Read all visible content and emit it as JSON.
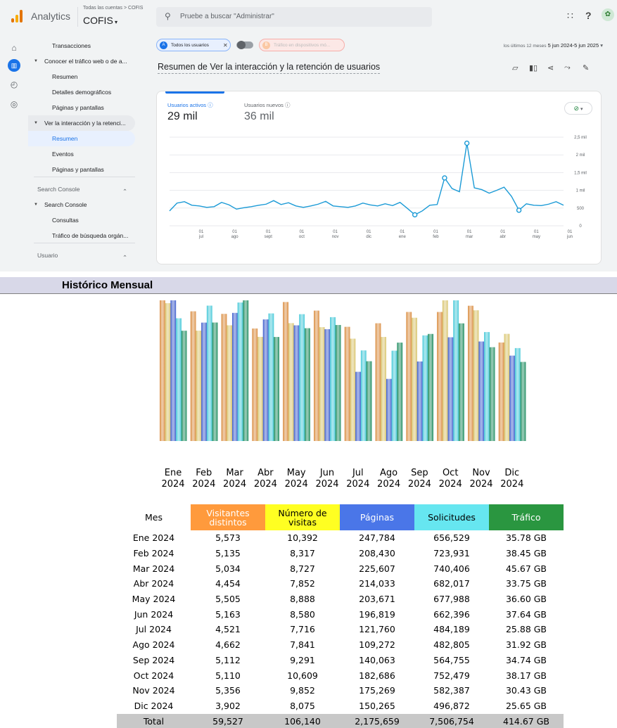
{
  "colors": {
    "accent": "#1a73e8",
    "line": "#1a9ad6",
    "bar_visitantes": "#d98a3c",
    "bar_visitas": "#d8c36a",
    "bar_paginas": "#3d5ccc",
    "bar_solicitudes": "#43c8d8",
    "bar_trafico": "#1a8a5c",
    "hdr_visitantes": "#ff9a3c",
    "hdr_visitas": "#ffff22",
    "hdr_paginas": "#4a76e8",
    "hdr_solicitudes": "#66e6f0",
    "hdr_trafico": "#2a9640"
  },
  "topbar": {
    "app_name": "Analytics",
    "crumb": "Todas las cuentas > COFIS",
    "account": "COFIS",
    "search_placeholder": "Pruebe a buscar \"Administrar\""
  },
  "rail": {
    "icons": [
      "home-icon",
      "reports-icon",
      "explore-icon",
      "advertising-icon"
    ]
  },
  "sidebar": {
    "items": [
      {
        "label": "Transacciones",
        "indent": 2
      },
      {
        "label": "Conocer el tráfico web o de a...",
        "indent": 1,
        "expand": true
      },
      {
        "label": "Resumen",
        "indent": 2
      },
      {
        "label": "Detalles demográficos",
        "indent": 2
      },
      {
        "label": "Páginas y pantallas",
        "indent": 2
      },
      {
        "label": "Ver la interacción y la retenci...",
        "indent": 1,
        "expand": true,
        "highlight": true
      },
      {
        "label": "Resumen",
        "indent": 2,
        "selected": true
      },
      {
        "label": "Eventos",
        "indent": 2
      },
      {
        "label": "Páginas y pantallas",
        "indent": 2
      },
      {
        "label": "Search Console",
        "indent": 0,
        "section": true
      },
      {
        "label": "Search Console",
        "indent": 1,
        "expand": true
      },
      {
        "label": "Consultas",
        "indent": 2
      },
      {
        "label": "Tráfico de búsqueda orgán...",
        "indent": 2
      },
      {
        "label": "Usuario",
        "indent": 0,
        "section": true
      }
    ]
  },
  "filters": {
    "chip_all": "Todos los usuarios",
    "chip_mobile": "Tráfico en dispositivos mó...",
    "date_prefix": "los últimos 12 meses",
    "date_range": "5 jun 2024-5 jun 2025"
  },
  "page_title": "Resumen de Ver la interacción y la retención de usuarios",
  "metrics": [
    {
      "label": "Usuarios activos",
      "value": "29 mil"
    },
    {
      "label": "Usuarios nuevos",
      "value": "36 mil"
    }
  ],
  "ga_chart": {
    "y_ticks": [
      "2,5 mil",
      "2 mil",
      "1,5 mil",
      "1 mil",
      "500",
      "0"
    ],
    "x_ticks": [
      [
        "01",
        "jul"
      ],
      [
        "01",
        "ago"
      ],
      [
        "01",
        "sept"
      ],
      [
        "01",
        "oct"
      ],
      [
        "01",
        "nov"
      ],
      [
        "01",
        "dic"
      ],
      [
        "01",
        "ene"
      ],
      [
        "01",
        "feb"
      ],
      [
        "01",
        "mar"
      ],
      [
        "01",
        "abr"
      ],
      [
        "01",
        "may"
      ],
      [
        "01",
        "jun"
      ]
    ],
    "ymax": 2500,
    "values": [
      420,
      640,
      680,
      580,
      560,
      520,
      540,
      660,
      590,
      470,
      510,
      540,
      580,
      610,
      710,
      600,
      650,
      560,
      520,
      560,
      610,
      690,
      560,
      540,
      520,
      560,
      640,
      590,
      560,
      620,
      570,
      660,
      490,
      310,
      420,
      580,
      600,
      1350,
      1050,
      960,
      2330,
      1070,
      1020,
      920,
      1000,
      1090,
      830,
      440,
      620,
      580,
      570,
      610,
      680,
      580
    ],
    "circles": [
      33,
      37,
      40,
      47
    ]
  },
  "historico": {
    "title": "Histórico Mensual",
    "months": [
      "Ene",
      "Feb",
      "Mar",
      "Abr",
      "May",
      "Jun",
      "Jul",
      "Ago",
      "Sep",
      "Oct",
      "Nov",
      "Dic"
    ],
    "years": [
      "2024",
      "2024",
      "2024",
      "2024",
      "2024",
      "2024",
      "2024",
      "2024",
      "2024",
      "2024",
      "2024",
      "2024"
    ],
    "chart_data": {
      "type": "bar",
      "categories": [
        "Ene 2024",
        "Feb 2024",
        "Mar 2024",
        "Abr 2024",
        "May 2024",
        "Jun 2024",
        "Jul 2024",
        "Ago 2024",
        "Sep 2024",
        "Oct 2024",
        "Nov 2024",
        "Dic 2024"
      ],
      "series": [
        {
          "values": [
            5573,
            5135,
            5034,
            4454,
            5505,
            5163,
            4521,
            4662,
            5112,
            5110,
            5356,
            3902
          ]
        },
        {
          "values": [
            10392,
            8317,
            8727,
            7852,
            8888,
            8580,
            7716,
            7841,
            9291,
            10609,
            9852,
            8075
          ]
        },
        {
          "values": [
            247784,
            208430,
            225607,
            214033,
            203671,
            196819,
            121760,
            109272,
            140063,
            182686,
            175269,
            150265
          ]
        },
        {
          "values": [
            656529,
            723931,
            740406,
            682017,
            677988,
            662396,
            484189,
            482805,
            564755,
            752479,
            582387,
            496872
          ]
        },
        {
          "values": [
            35.78,
            38.45,
            45.67,
            33.75,
            36.6,
            37.64,
            25.88,
            31.92,
            34.74,
            38.17,
            30.43,
            25.65
          ]
        }
      ]
    },
    "table": {
      "headers": [
        "Mes",
        "Visitantes distintos",
        "Número de visitas",
        "Páginas",
        "Solicitudes",
        "Tráfico"
      ],
      "rows": [
        [
          "Ene 2024",
          "5,573",
          "10,392",
          "247,784",
          "656,529",
          "35.78 GB"
        ],
        [
          "Feb 2024",
          "5,135",
          "8,317",
          "208,430",
          "723,931",
          "38.45 GB"
        ],
        [
          "Mar 2024",
          "5,034",
          "8,727",
          "225,607",
          "740,406",
          "45.67 GB"
        ],
        [
          "Abr 2024",
          "4,454",
          "7,852",
          "214,033",
          "682,017",
          "33.75 GB"
        ],
        [
          "May 2024",
          "5,505",
          "8,888",
          "203,671",
          "677,988",
          "36.60 GB"
        ],
        [
          "Jun 2024",
          "5,163",
          "8,580",
          "196,819",
          "662,396",
          "37.64 GB"
        ],
        [
          "Jul 2024",
          "4,521",
          "7,716",
          "121,760",
          "484,189",
          "25.88 GB"
        ],
        [
          "Ago 2024",
          "4,662",
          "7,841",
          "109,272",
          "482,805",
          "31.92 GB"
        ],
        [
          "Sep 2024",
          "5,112",
          "9,291",
          "140,063",
          "564,755",
          "34.74 GB"
        ],
        [
          "Oct 2024",
          "5,110",
          "10,609",
          "182,686",
          "752,479",
          "38.17 GB"
        ],
        [
          "Nov 2024",
          "5,356",
          "9,852",
          "175,269",
          "582,387",
          "30.43 GB"
        ],
        [
          "Dic 2024",
          "3,902",
          "8,075",
          "150,265",
          "496,872",
          "25.65 GB"
        ]
      ],
      "total": [
        "Total",
        "59,527",
        "106,140",
        "2,175,659",
        "7,506,754",
        "414.67 GB"
      ]
    }
  }
}
